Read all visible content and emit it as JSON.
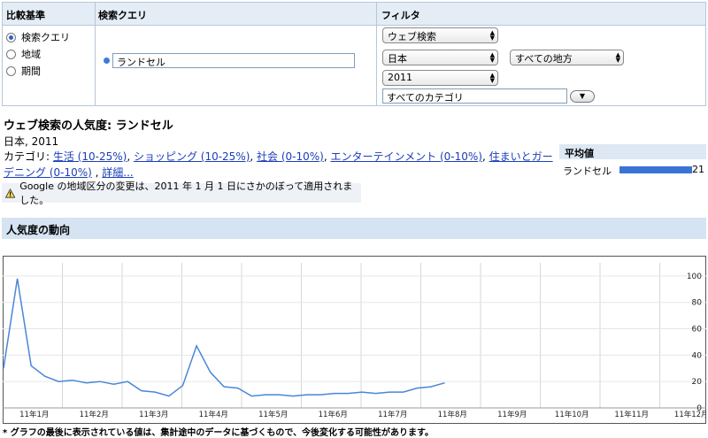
{
  "panel": {
    "compare_header": "比較基準",
    "query_header": "検索クエリ",
    "filter_header": "フィルタ",
    "radio_options": [
      {
        "label": "検索クエリ",
        "checked": true
      },
      {
        "label": "地域",
        "checked": false
      },
      {
        "label": "期間",
        "checked": false
      }
    ],
    "search_term": "ランドセル",
    "term_color": "#3d7bd8",
    "filters": {
      "search_type": "ウェブ検索",
      "country": "日本",
      "region": "すべての地方",
      "year": "2011",
      "category": "すべてのカテゴリ"
    }
  },
  "summary": {
    "title": "ウェブ検索の人気度: ランドセル",
    "subtitle": "日本, 2011",
    "categories_label": "カテゴリ: ",
    "categories": [
      "生活 (10-25%)",
      "ショッピング (10-25%)",
      "社会 (0-10%)",
      "エンターテインメント (0-10%)",
      "住まいとガーデニング (0-10%)"
    ],
    "more_link": "詳細..."
  },
  "average": {
    "header": "平均値",
    "term": "ランドセル",
    "value": 21,
    "bar_color": "#3b73d4"
  },
  "notice": {
    "icon": "warning-icon",
    "text": "Google の地域区分の変更は、2011 年 1 月 1 日にさかのぼって適用されました。"
  },
  "trend": {
    "header": "人気度の動向",
    "footnote": "* グラフの最後に表示されている値は、集計途中のデータに基づくもので、今後変化する可能性があります。"
  },
  "chart_data": {
    "type": "line",
    "title": "",
    "xlabel": "",
    "ylabel": "",
    "ylim": [
      0,
      110
    ],
    "yticks": [
      0,
      20,
      40,
      60,
      80,
      100
    ],
    "x_labels": [
      "11年1月",
      "11年2月",
      "11年3月",
      "11年4月",
      "11年5月",
      "11年6月",
      "11年7月",
      "11年8月",
      "11年9月",
      "11年10月",
      "11年11月",
      "11年12月"
    ],
    "grid": true,
    "line_color": "#4a86d8",
    "series": [
      {
        "values": [
          30,
          98,
          32,
          24,
          20,
          21,
          19,
          20,
          18,
          20,
          13,
          12,
          9,
          17,
          47,
          27,
          16,
          15,
          9,
          10,
          10,
          9,
          10,
          10,
          11,
          11,
          12,
          11,
          12,
          12,
          15,
          16,
          19
        ]
      }
    ]
  }
}
